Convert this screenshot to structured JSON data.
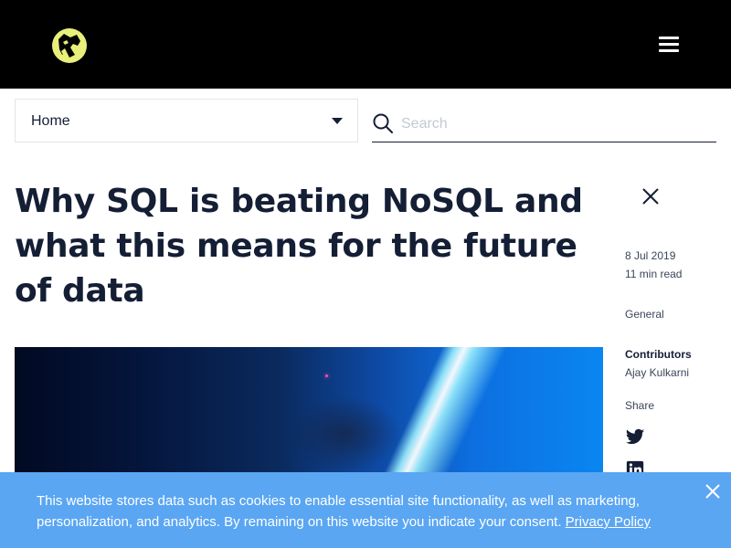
{
  "header": {
    "logo_icon": "cat-face-logo-icon",
    "menu_icon": "hamburger-menu-icon",
    "accent_color": "#e8ef7a"
  },
  "nav": {
    "select_value": "Home",
    "caret_icon": "caret-down-icon"
  },
  "search": {
    "placeholder": "Search",
    "value": "",
    "icon": "search-icon"
  },
  "article": {
    "title": "Why SQL is beating NoSQL and what this means for the future of data",
    "close_icon": "close-icon",
    "date": "8 Jul 2019",
    "read_time": "11 min read",
    "category": "General",
    "contributors_label": "Contributors",
    "contributor": "Ajay Kulkarni",
    "share_label": "Share",
    "share_icons": [
      "twitter-icon",
      "linkedin-icon"
    ],
    "hero_image": "blue-lightsaber-photo"
  },
  "cookie_banner": {
    "text_part1": "This website stores data such as cookies to enable essential site functionality, as well as marketing, personalization, and analytics. By remaining on this website you indicate your consent.",
    "link_label": "Privacy Policy",
    "close_icon": "close-icon",
    "background": "#5aa6f2"
  }
}
